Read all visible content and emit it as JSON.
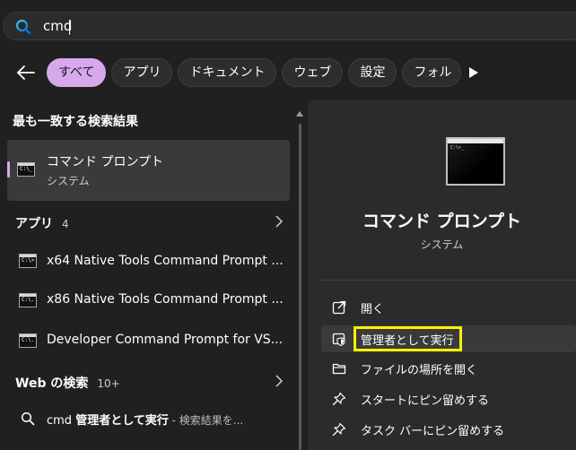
{
  "search": {
    "value": "cmd"
  },
  "filters": {
    "chips": [
      "すべて",
      "アプリ",
      "ドキュメント",
      "ウェブ",
      "設定",
      "フォル"
    ]
  },
  "best_match": {
    "heading": "最も一致する検索結果",
    "title": "コマンド プロンプト",
    "subtitle": "システム",
    "icon_text": "C:\\_"
  },
  "apps": {
    "heading": "アプリ",
    "count": "4",
    "items": [
      {
        "label": "x64 Native Tools Command Prompt ...",
        "icon_text": "C:\\>"
      },
      {
        "label": "x86 Native Tools Command Prompt ...",
        "icon_text": "C:\\."
      },
      {
        "label": "Developer Command Prompt for VS...",
        "icon_text": "C:\\."
      }
    ]
  },
  "web": {
    "heading": "Web の検索",
    "count": "10+",
    "query_plain": "cmd ",
    "query_bold": "管理者として実行",
    "hint": " - 検索結果を..."
  },
  "detail": {
    "title": "コマンド プロンプト",
    "subtitle": "システム",
    "icon_text": "C:\\>_",
    "actions": [
      {
        "label": "開く",
        "icon": "open-external-icon"
      },
      {
        "label": "管理者として実行",
        "icon": "admin-shield-icon"
      },
      {
        "label": "ファイルの場所を開く",
        "icon": "folder-icon"
      },
      {
        "label": "スタートにピン留めする",
        "icon": "pin-icon"
      },
      {
        "label": "タスク バーにピン留めする",
        "icon": "pin-icon"
      }
    ]
  },
  "colors": {
    "accent": "#d7a9ec",
    "highlight": "#fff200",
    "background": "#202020",
    "panel": "#2b2b2b"
  }
}
